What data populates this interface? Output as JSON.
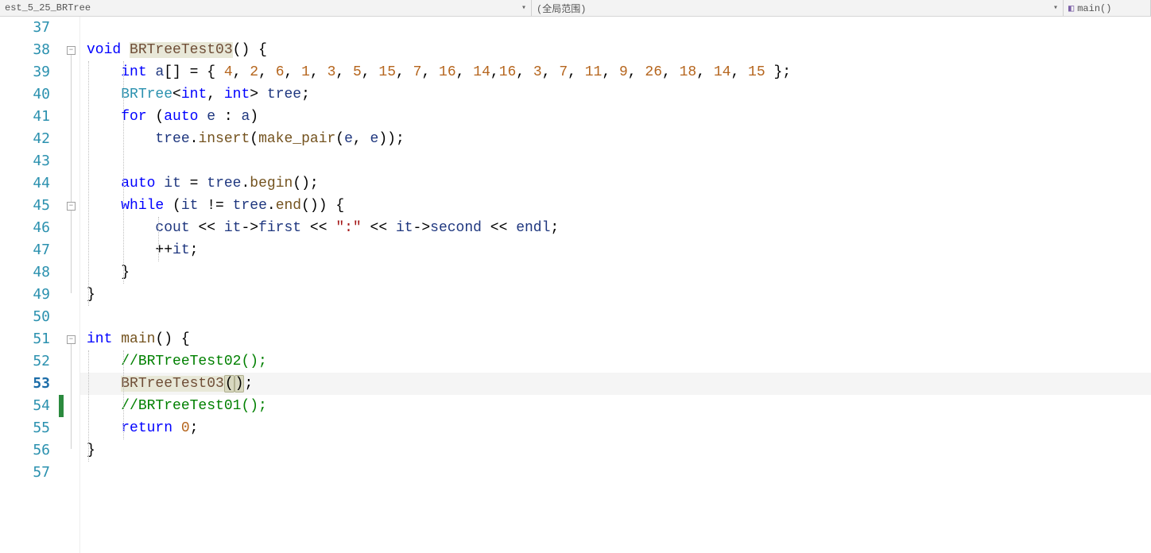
{
  "topbar": {
    "left_tab": "est_5_25_BRTree",
    "middle_tab": "(全局范围)",
    "right_tab": "main()"
  },
  "line_numbers": [
    "37",
    "38",
    "39",
    "40",
    "41",
    "42",
    "43",
    "44",
    "45",
    "46",
    "47",
    "48",
    "49",
    "50",
    "51",
    "52",
    "53",
    "54",
    "55",
    "56",
    "57"
  ],
  "current_line_index": 16,
  "change_marker": {
    "top_line_index": 17,
    "height_lines": 1
  },
  "fold_boxes": [
    {
      "line_index": 1,
      "symbol": "−"
    },
    {
      "line_index": 8,
      "symbol": "−"
    },
    {
      "line_index": 14,
      "symbol": "−"
    }
  ],
  "code": {
    "l37": "",
    "l38": {
      "kw1": "void",
      "fn": "BRTreeTest03",
      "paren": "()",
      "brace": " {"
    },
    "l39": {
      "indent": "    ",
      "kw": "int",
      "id": "a",
      "brackets": "[]",
      "eq": " = { ",
      "nums": [
        "4",
        "2",
        "6",
        "1",
        "3",
        "5",
        "15",
        "7",
        "16",
        "14",
        "16",
        "3",
        "7",
        "11",
        "9",
        "26",
        "18",
        "14",
        "15"
      ],
      "close": " };"
    },
    "l40": {
      "indent": "    ",
      "type": "BRTree",
      "lt": "<",
      "t1": "int",
      "comma": ", ",
      "t2": "int",
      "gt": ">",
      "sp": " ",
      "id": "tree",
      "semi": ";"
    },
    "l41": {
      "indent": "    ",
      "kw1": "for",
      "open": " (",
      "kw2": "auto",
      "sp": " ",
      "id1": "e",
      "colon": " : ",
      "id2": "a",
      "close": ")"
    },
    "l42": {
      "indent": "        ",
      "id1": "tree",
      "dot": ".",
      "fn": "insert",
      "open": "(",
      "fn2": "make_pair",
      "open2": "(",
      "id2": "e",
      "comma": ", ",
      "id3": "e",
      "close2": ")",
      "close": ")",
      "semi": ";"
    },
    "l43": "",
    "l44": {
      "indent": "    ",
      "kw": "auto",
      "sp": " ",
      "id": "it",
      "eq": " = ",
      "id2": "tree",
      "dot": ".",
      "fn": "begin",
      "paren": "()",
      "semi": ";"
    },
    "l45": {
      "indent": "    ",
      "kw": "while",
      "open": " (",
      "id": "it",
      "neq": " != ",
      "id2": "tree",
      "dot": ".",
      "fn": "end",
      "paren": "()",
      "close": ")",
      "brace": " {"
    },
    "l46": {
      "indent": "        ",
      "id": "cout",
      "op1": " << ",
      "id2": "it",
      "arrow": "->",
      "fld": "first",
      "op2": " << ",
      "str": "\":\"",
      "op3": " << ",
      "id3": "it",
      "arrow2": "->",
      "fld2": "second",
      "op4": " << ",
      "id4": "endl",
      "semi": ";"
    },
    "l47": {
      "indent": "        ",
      "op": "++",
      "id": "it",
      "semi": ";"
    },
    "l48": {
      "indent": "    ",
      "brace": "}"
    },
    "l49": {
      "brace": "}"
    },
    "l50": "",
    "l51": {
      "kw": "int",
      "sp": " ",
      "fn": "main",
      "paren": "()",
      "brace": " {"
    },
    "l52": {
      "indent": "    ",
      "comment": "//BRTreeTest02();"
    },
    "l53": {
      "indent": "    ",
      "fn": "BRTreeTest03",
      "open": "(",
      "close": ")",
      "semi": ";"
    },
    "l54": {
      "indent": "    ",
      "comment": "//BRTreeTest01();"
    },
    "l55": {
      "indent": "    ",
      "kw": "return",
      "sp": " ",
      "num": "0",
      "semi": ";"
    },
    "l56": {
      "brace": "}"
    },
    "l57": ""
  }
}
